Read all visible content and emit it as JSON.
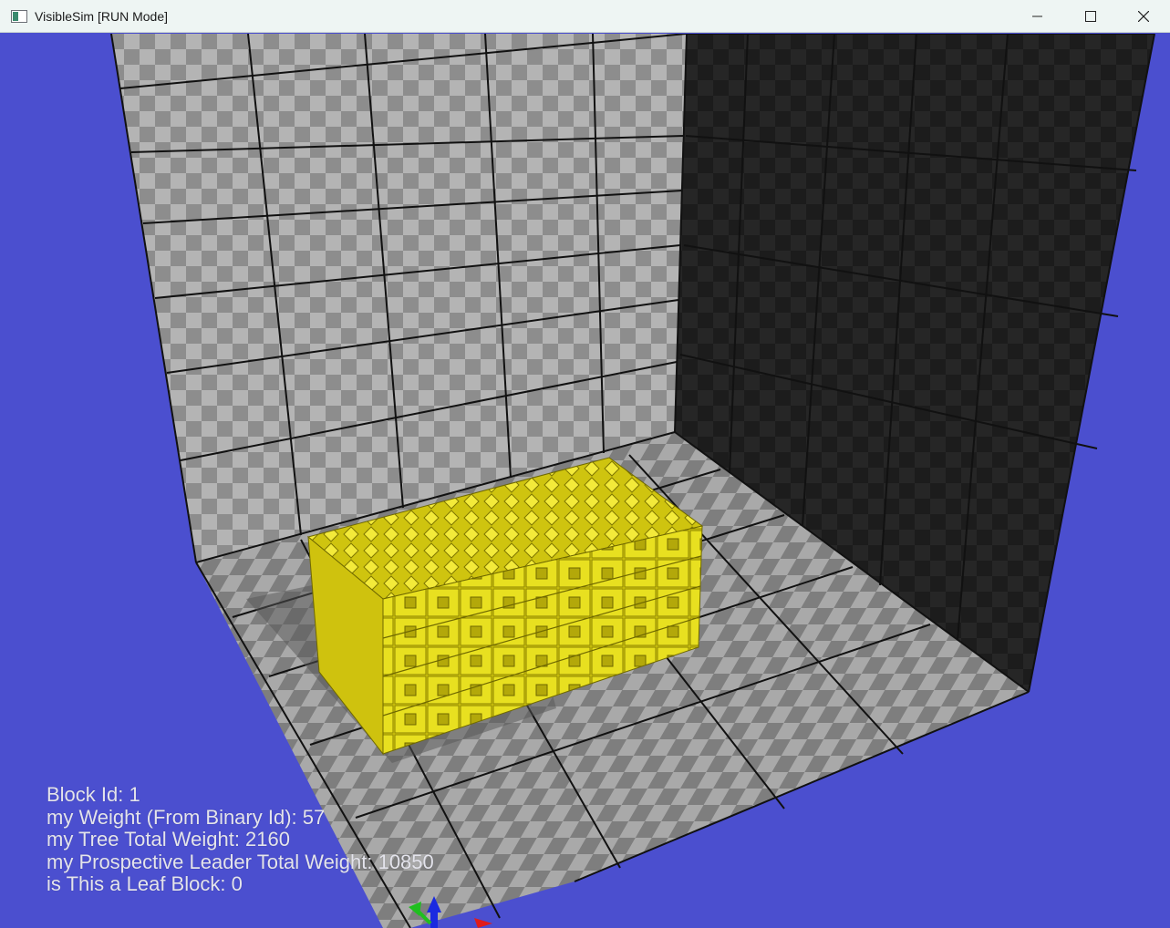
{
  "window": {
    "title": "VisibleSim [RUN Mode]",
    "icon": "app-window-icon",
    "controls": {
      "minimize": "minimize-icon",
      "maximize": "maximize-icon",
      "close": "close-icon"
    }
  },
  "scene": {
    "background_color": "#4b4fcf",
    "block_color": "#e6dc1a",
    "block_grid": {
      "columns": 11,
      "rows": 4
    },
    "axes_colors": {
      "x": "#e01b1b",
      "y": "#1fbf1f",
      "z": "#1a2ae0"
    }
  },
  "info": {
    "block_id": "Block Id: 1",
    "weight": "my Weight (From Binary Id): 57",
    "tree_total_weight": "my Tree Total Weight: 2160",
    "prospective_leader_weight": "my Prospective Leader Total Weight: 10850",
    "is_leaf": "is This a Leaf Block: 0"
  }
}
